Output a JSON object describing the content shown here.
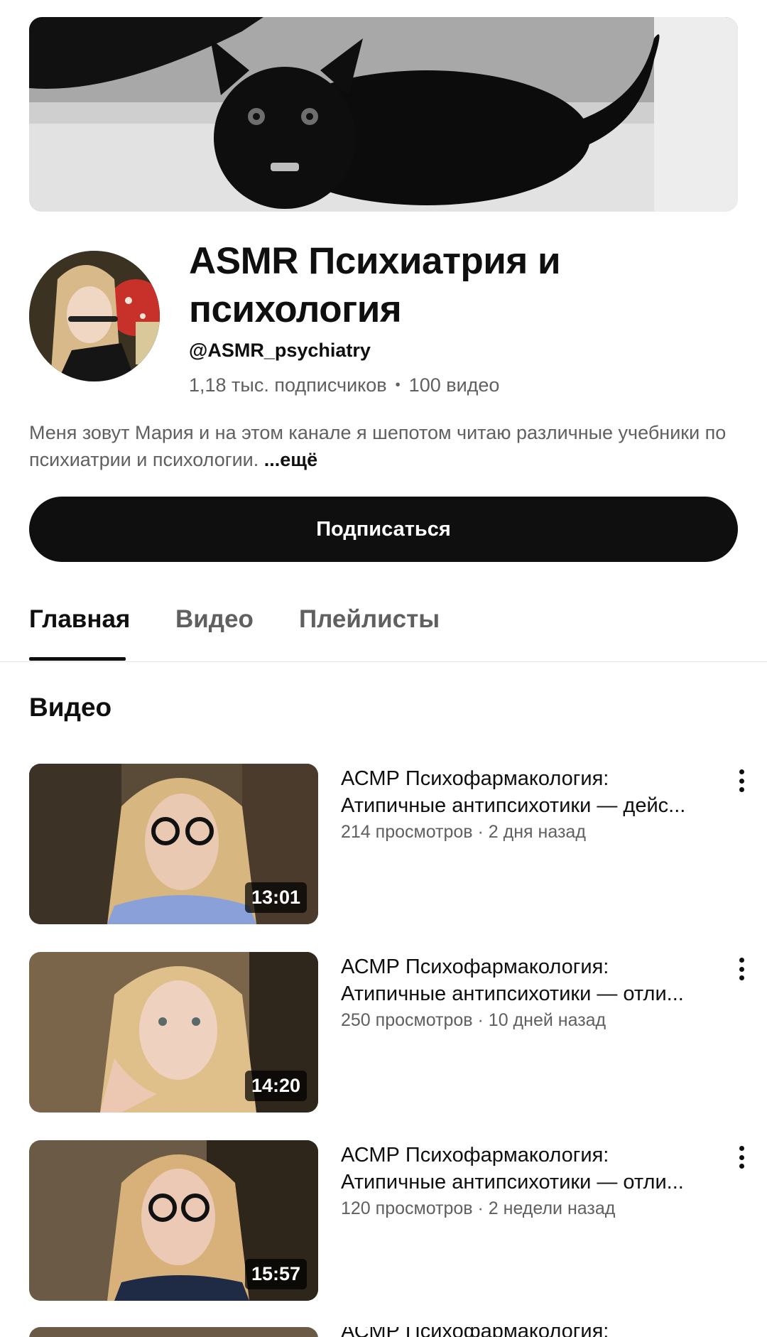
{
  "channel": {
    "title": "ASMR Психиатрия и психология",
    "handle": "@ASMR_psychiatry",
    "subscribers": "1,18 тыс. подписчиков",
    "separator": "•",
    "videos_count": "100 видео",
    "description": "Меня зовут Мария и на этом канале я шепотом читаю различные учебники по психиатрии и психологии.",
    "more_label": "...ещё"
  },
  "subscribe_label": "Подписаться",
  "tabs": [
    {
      "label": "Главная",
      "active": true
    },
    {
      "label": "Видео",
      "active": false
    },
    {
      "label": "Плейлисты",
      "active": false
    }
  ],
  "section_title": "Видео",
  "videos": [
    {
      "title_line1": "АСМР Психофармакология:",
      "title_line2": "Атипичные антипсихотики — дейс...",
      "meta": "214 просмотров · 2 дня назад",
      "duration": "13:01"
    },
    {
      "title_line1": "АСМР Психофармакология:",
      "title_line2": "Атипичные антипсихотики — отли...",
      "meta": "250 просмотров · 10 дней назад",
      "duration": "14:20"
    },
    {
      "title_line1": "АСМР Психофармакология:",
      "title_line2": "Атипичные антипсихотики — отли...",
      "meta": "120 просмотров · 2 недели назад",
      "duration": "15:57"
    }
  ],
  "partial_video": {
    "title_line1": "АСМР Психофармакология:"
  },
  "colors": {
    "primary_text": "#0f0f0f",
    "secondary_text": "#606060",
    "button_bg": "#0f0f0f",
    "divider": "#e5e5e5"
  },
  "icons": [
    "more-vert-icon"
  ]
}
